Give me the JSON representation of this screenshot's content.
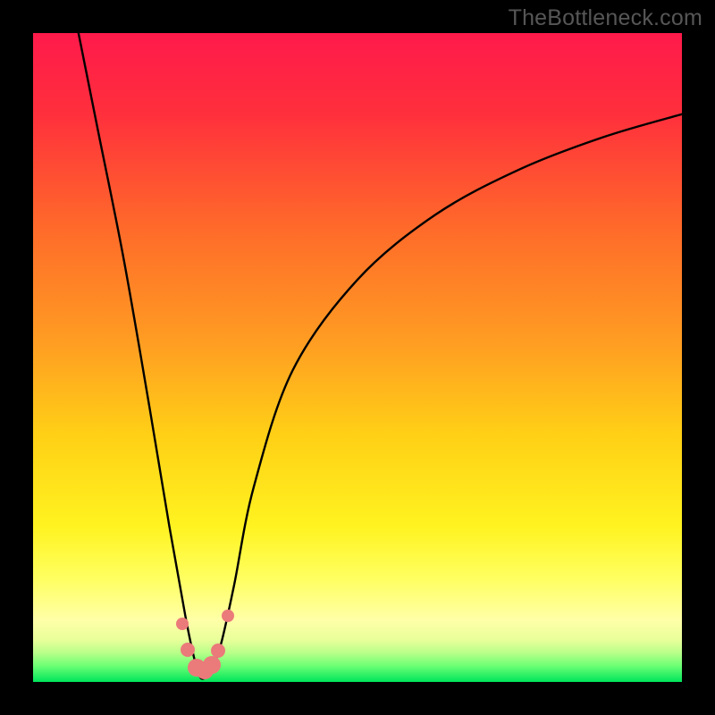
{
  "watermark": "TheBottleneck.com",
  "chart_data": {
    "type": "line",
    "title": "",
    "xlabel": "",
    "ylabel": "",
    "xlim": [
      0,
      100
    ],
    "ylim": [
      0,
      100
    ],
    "description": "Bottleneck percentage curve over a red-to-green gradient; minimum (optimal) near x≈26.",
    "gradient_stops": [
      {
        "pos": 0.0,
        "color": "#ff1a4b"
      },
      {
        "pos": 0.12,
        "color": "#ff2e3d"
      },
      {
        "pos": 0.3,
        "color": "#ff6a2a"
      },
      {
        "pos": 0.48,
        "color": "#ff9e22"
      },
      {
        "pos": 0.62,
        "color": "#ffd016"
      },
      {
        "pos": 0.76,
        "color": "#fff320"
      },
      {
        "pos": 0.84,
        "color": "#ffff60"
      },
      {
        "pos": 0.905,
        "color": "#ffffa8"
      },
      {
        "pos": 0.935,
        "color": "#e9ff9a"
      },
      {
        "pos": 0.955,
        "color": "#b9ff8a"
      },
      {
        "pos": 0.975,
        "color": "#6dff74"
      },
      {
        "pos": 1.0,
        "color": "#00e55b"
      }
    ],
    "series": [
      {
        "name": "bottleneck-curve",
        "x": [
          7,
          10,
          14,
          18,
          21,
          23.5,
          25,
          26,
          27.5,
          29,
          31,
          34,
          40,
          50,
          62,
          75,
          88,
          100
        ],
        "y": [
          100,
          85,
          65,
          42,
          24,
          10,
          3,
          0.5,
          2,
          6,
          15,
          30,
          48,
          62,
          72,
          79,
          84,
          87.5
        ]
      }
    ],
    "markers": {
      "color": "#eb7a7a",
      "points": [
        {
          "x": 23.0,
          "y": 9.0,
          "r": 7
        },
        {
          "x": 23.8,
          "y": 5.0,
          "r": 8
        },
        {
          "x": 25.2,
          "y": 2.2,
          "r": 10
        },
        {
          "x": 26.5,
          "y": 1.8,
          "r": 10
        },
        {
          "x": 27.6,
          "y": 2.6,
          "r": 10
        },
        {
          "x": 28.5,
          "y": 4.8,
          "r": 8
        },
        {
          "x": 30.0,
          "y": 10.2,
          "r": 7
        }
      ]
    }
  }
}
